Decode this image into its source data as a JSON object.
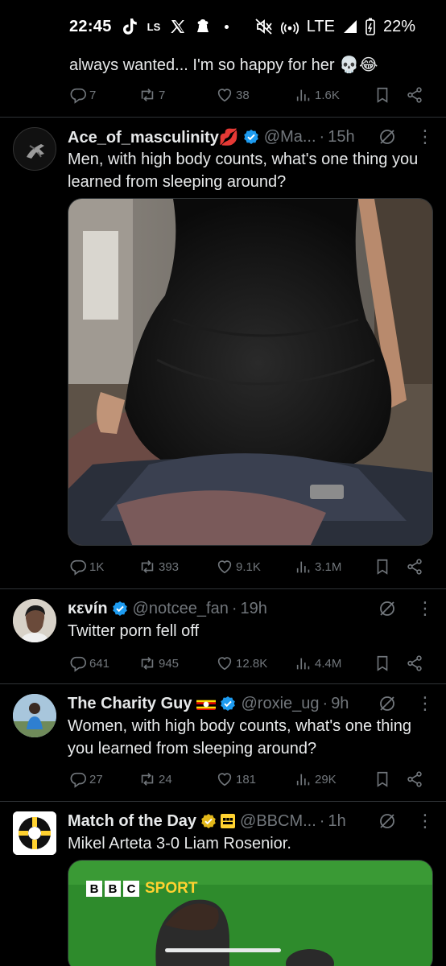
{
  "status_bar": {
    "time": "22:45",
    "ls_label": "LS",
    "network": "LTE",
    "battery": "22%"
  },
  "previous_tweet": {
    "text": "always wanted... I'm so happy for her 💀😂",
    "replies": "7",
    "retweets": "7",
    "likes": "38",
    "views": "1.6K"
  },
  "tweets": [
    {
      "name": "Ace_of_masculinity💋",
      "handle": "@Ma...",
      "time": "15h",
      "text": "Men, with high body counts, what's one thing you learned from sleeping around?",
      "replies": "1K",
      "retweets": "393",
      "likes": "9.1K",
      "views": "3.1M"
    },
    {
      "name": "κενín",
      "handle": "@notcee_fan",
      "time": "19h",
      "text": "Twitter porn fell off",
      "replies": "641",
      "retweets": "945",
      "likes": "12.8K",
      "views": "4.4M"
    },
    {
      "name": "The Charity Guy",
      "handle": "@roxie_ug",
      "time": "9h",
      "text": "Women, with high body counts, what's one thing you learned from sleeping around?",
      "replies": "27",
      "retweets": "24",
      "likes": "181",
      "views": "29K"
    },
    {
      "name": "Match of the Day",
      "handle": "@BBCM...",
      "time": "1h",
      "text": "Mikel Arteta 3-0 Liam Rosenior.",
      "media_logo_letters": [
        "B",
        "B",
        "C"
      ],
      "media_logo_word": "SPORT"
    }
  ],
  "colors": {
    "background": "#000000",
    "text": "#e7e9ea",
    "muted": "#71767b",
    "divider": "#2f3336",
    "verified_blue": "#1d9bf0",
    "verified_gold": "#e2b719",
    "bbc_sport_yellow": "#ffd230"
  }
}
